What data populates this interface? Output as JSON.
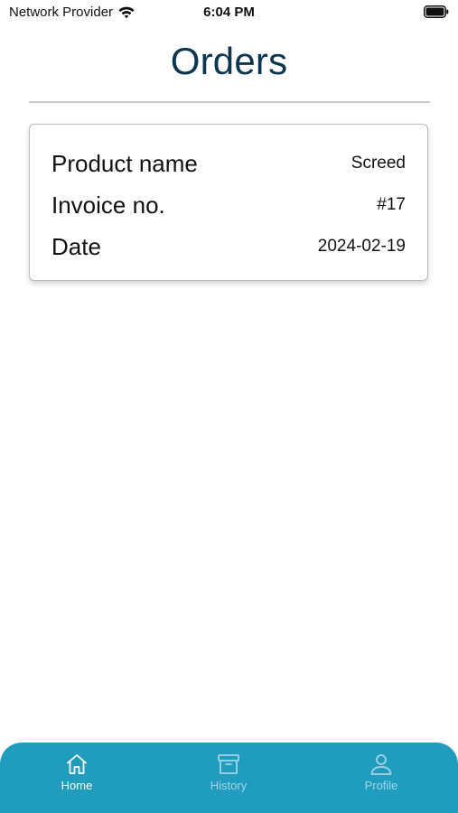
{
  "status_bar": {
    "carrier": "Network Provider",
    "time": "6:04 PM"
  },
  "header": {
    "title": "Orders"
  },
  "order": {
    "rows": [
      {
        "label": "Product name",
        "value": "Screed"
      },
      {
        "label": "Invoice no.",
        "value": "#17"
      },
      {
        "label": "Date",
        "value": "2024-02-19"
      }
    ]
  },
  "tab_bar": {
    "tabs": [
      {
        "label": "Home",
        "icon": "home-icon",
        "active": true
      },
      {
        "label": "History",
        "icon": "archive-icon",
        "active": false
      },
      {
        "label": "Profile",
        "icon": "user-icon",
        "active": false
      }
    ]
  },
  "colors": {
    "title": "#0c3550",
    "tab_bar": "#229cbd",
    "tab_active": "#ffffff",
    "tab_inactive": "#9fd6e6"
  }
}
